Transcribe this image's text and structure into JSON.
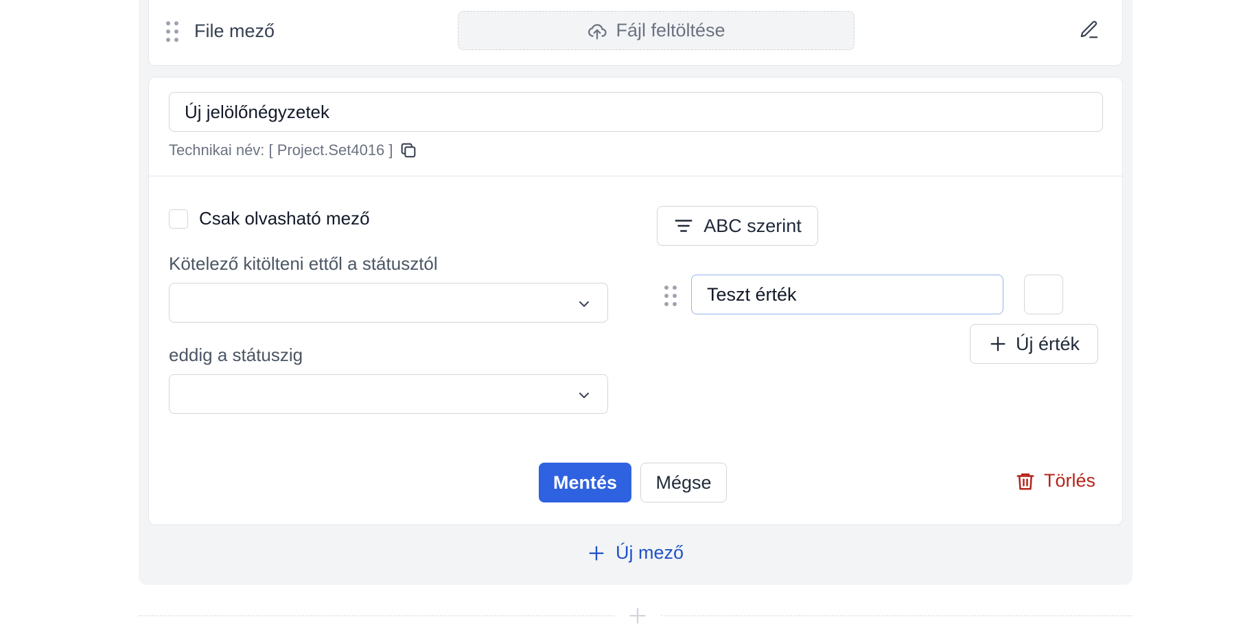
{
  "file_row": {
    "label": "File mező",
    "upload_label": "Fájl feltöltése"
  },
  "field_editor": {
    "name_value": "Új jelölőnégyzetek",
    "technical_name": "Technikai név: [ Project.Set4016 ]",
    "readonly_label": "Csak olvasható mező",
    "required_from_label": "Kötelező kitölteni ettől a státusztól",
    "required_to_label": "eddig a státuszig",
    "sort_label": "ABC szerint",
    "value_text": "Teszt érték",
    "new_value_label": "Új érték",
    "save_label": "Mentés",
    "cancel_label": "Mégse",
    "delete_label": "Törlés"
  },
  "new_field_label": "Új mező",
  "colors": {
    "primary": "#2f62e0",
    "danger": "#b42318",
    "link": "#2052c8",
    "panel_bg": "#f3f4f6"
  }
}
